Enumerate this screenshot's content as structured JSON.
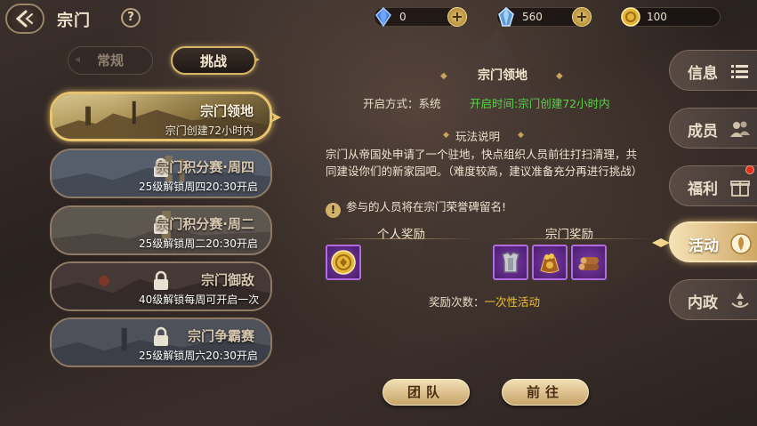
{
  "header": {
    "title": "宗门",
    "help": "?",
    "resources": [
      {
        "icon": "blue-gem-icon",
        "value": "0",
        "plus": "+"
      },
      {
        "icon": "crystal-gem-icon",
        "value": "560",
        "plus": "+"
      },
      {
        "icon": "gold-coin-icon",
        "value": "100"
      }
    ]
  },
  "tabs": [
    {
      "label": "常规",
      "active": false
    },
    {
      "label": "挑战",
      "active": true
    }
  ],
  "events": [
    {
      "name": "宗门领地",
      "sub": "宗门创建72小时内",
      "locked": false,
      "active": true
    },
    {
      "name": "宗门积分赛·周四",
      "lock_text": "25级解锁",
      "sub": "周四20:30开启",
      "locked": true
    },
    {
      "name": "宗门积分赛·周二",
      "lock_text": "25级解锁",
      "sub": "周二20:30开启",
      "locked": true
    },
    {
      "name": "宗门御敌",
      "lock_text": "40级解锁",
      "sub": "每周可开启一次",
      "locked": true
    },
    {
      "name": "宗门争霸赛",
      "lock_text": "25级解锁",
      "sub": "周六20:30开启",
      "locked": true
    }
  ],
  "detail": {
    "title": "宗门领地",
    "open_mode_label": "开启方式：",
    "open_mode_value": "系统",
    "open_time_label": "开启时间:",
    "open_time_value": "宗门创建72小时内",
    "rules_title": "玩法说明",
    "description": "宗门从帝国处申请了一个驻地，快点组织人员前往打扫清理，共同建设你们的新家园吧。（难度较高，建议准备充分再进行挑战）",
    "note": "参与的人员将在宗门荣誉碑留名!",
    "personal_reward_title": "个人奖励",
    "sect_reward_title": "宗门奖励",
    "personal_rewards": [
      "gold-medal-icon"
    ],
    "sect_rewards": [
      "armor-icon",
      "treasure-bag-icon",
      "wood-logs-icon"
    ],
    "reward_count_label": "奖励次数：",
    "reward_count_value": "一次性活动"
  },
  "buttons": {
    "team": "团队",
    "go": "前往"
  },
  "side_nav": [
    {
      "label": "信息",
      "icon": "list-icon",
      "active": false
    },
    {
      "label": "成员",
      "icon": "members-icon",
      "active": false
    },
    {
      "label": "福利",
      "icon": "gift-icon",
      "active": false,
      "badge": true
    },
    {
      "label": "活动",
      "icon": "activity-icon",
      "active": true
    },
    {
      "label": "内政",
      "icon": "affairs-icon",
      "active": false
    }
  ],
  "colors": {
    "accent_gold": "#d9b56a",
    "green_text": "#58d44a",
    "purple_item": "#7a3aa6",
    "badge_red": "#e0301e"
  }
}
